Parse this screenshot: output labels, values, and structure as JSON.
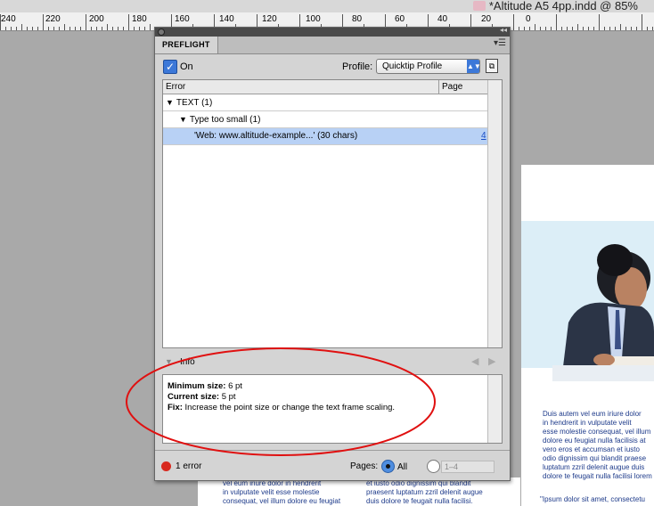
{
  "document": {
    "title": "*Altitude A5 4pp.indd @ 85%"
  },
  "ruler": {
    "labels": [
      "240",
      "220",
      "200",
      "180",
      "160",
      "140",
      "120",
      "100",
      "80",
      "60",
      "40",
      "20",
      "0"
    ]
  },
  "panel": {
    "tab_label": "PREFLIGHT",
    "on_label": "On",
    "on_checked": true,
    "profile_label": "Profile:",
    "profile_value": "Quicktip Profile",
    "columns": {
      "error": "Error",
      "page": "Page"
    },
    "rows": [
      {
        "text": "TEXT (1)",
        "page": ""
      },
      {
        "text": "Type too small (1)",
        "page": ""
      },
      {
        "text": "'Web: www.altitude-example...' (30 chars)",
        "page": "4"
      }
    ],
    "info_label": "Info",
    "info": {
      "min_label": "Minimum size:",
      "min_value": "6 pt",
      "current_label": "Current size:",
      "current_value": "5 pt",
      "fix_label": "Fix:",
      "fix_value": "Increase the point size or change the text frame scaling."
    },
    "status": "1 error",
    "pages_label": "Pages:",
    "all_label": "All",
    "range_value": "1–4",
    "pages_selected": "All"
  },
  "document_page": {
    "right_column": [
      "Duis autem vel eum iriure dolor",
      "in hendrerit in vulputate velit",
      "esse molestie consequat, vel illum",
      "dolore eu feugiat nulla facilisis at",
      "vero eros et accumsan et iusto",
      "odio dignissim qui blandit praese",
      "luptatum zzril delenit augue duis",
      "dolore te feugait nulla facilisi lorem"
    ],
    "right_column_bottom": "\"Ipsum dolor sit amet, consectetu",
    "left_column": [
      "vel eum iriure dolor in hendrerit",
      "in vulputate velit esse molestie",
      "consequat, vel illum dolore eu feugiat"
    ],
    "mid_column": [
      "et iusto odio dignissim qui blandit",
      "praesent luptatum zzril delenit augue",
      "duis dolore te feugait nulla facilisi."
    ]
  },
  "colors": {
    "selection": "#b8d1f5",
    "error_dot": "#d8291f",
    "annotation": "#e01010",
    "body_text": "#1d3a8a"
  }
}
